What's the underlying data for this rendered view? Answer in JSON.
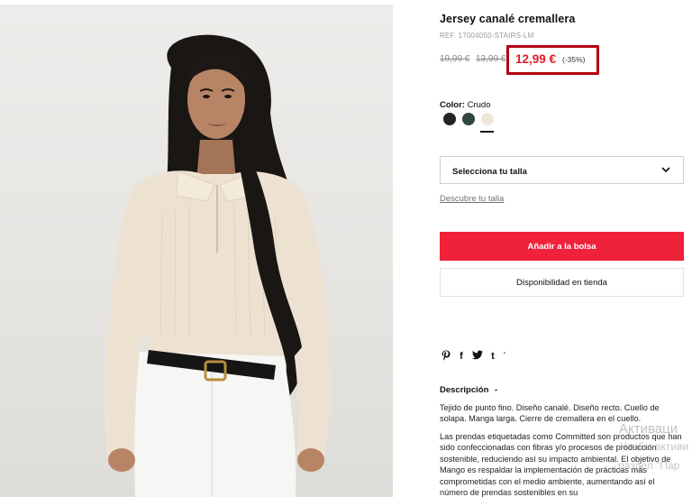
{
  "product": {
    "title": "Jersey canalé cremallera",
    "ref": "REF. 17004050-STAIRS-LM",
    "old_prices": [
      "19,99 €",
      "13,99 €"
    ],
    "price": "12,99 €",
    "discount": "(-35%)",
    "highlight_color": "#b4000f",
    "sale_color": "#e21c2a"
  },
  "color": {
    "label": "Color:",
    "selected": "Crudo",
    "swatches": [
      {
        "name": "black",
        "hex": "#222426"
      },
      {
        "name": "dark-green",
        "hex": "#2f4643"
      },
      {
        "name": "crudo",
        "hex": "#efe7dc",
        "selected": true
      }
    ]
  },
  "size": {
    "select_label": "Selecciona tu talla",
    "guide_link": "Descubre tu talla"
  },
  "actions": {
    "add_to_bag": "Añadir a la bolsa",
    "store_availability": "Disponibilidad en tienda",
    "accent": "#f0213a"
  },
  "share": {
    "icons": [
      "pinterest-icon",
      "facebook-icon",
      "twitter-icon",
      "tumblr-icon",
      "more-icon"
    ],
    "glyphs": [
      "P",
      "f",
      "y",
      "t",
      "'"
    ]
  },
  "description": {
    "title": "Descripción",
    "toggle": "-",
    "p1": "Tejido de punto fino. Diseño canalé. Diseño recto. Cuello de solapa. Manga larga. Cierre de cremallera en el cuello.",
    "p2": "Las prendas etiquetadas como Committed son productos que han sido confeccionadas con fibras y/o procesos de producción sostenible, reduciendo así su impacto ambiental. El objetivo de Mango es respaldar la implementación de prácticas más comprometidas con el medio ambiente, aumentando así el número de prendas sostenibles en su"
  },
  "watermark": {
    "line1": "Активаци",
    "line2": "Чтобы активи",
    "line3": "раздел \"Пар"
  }
}
